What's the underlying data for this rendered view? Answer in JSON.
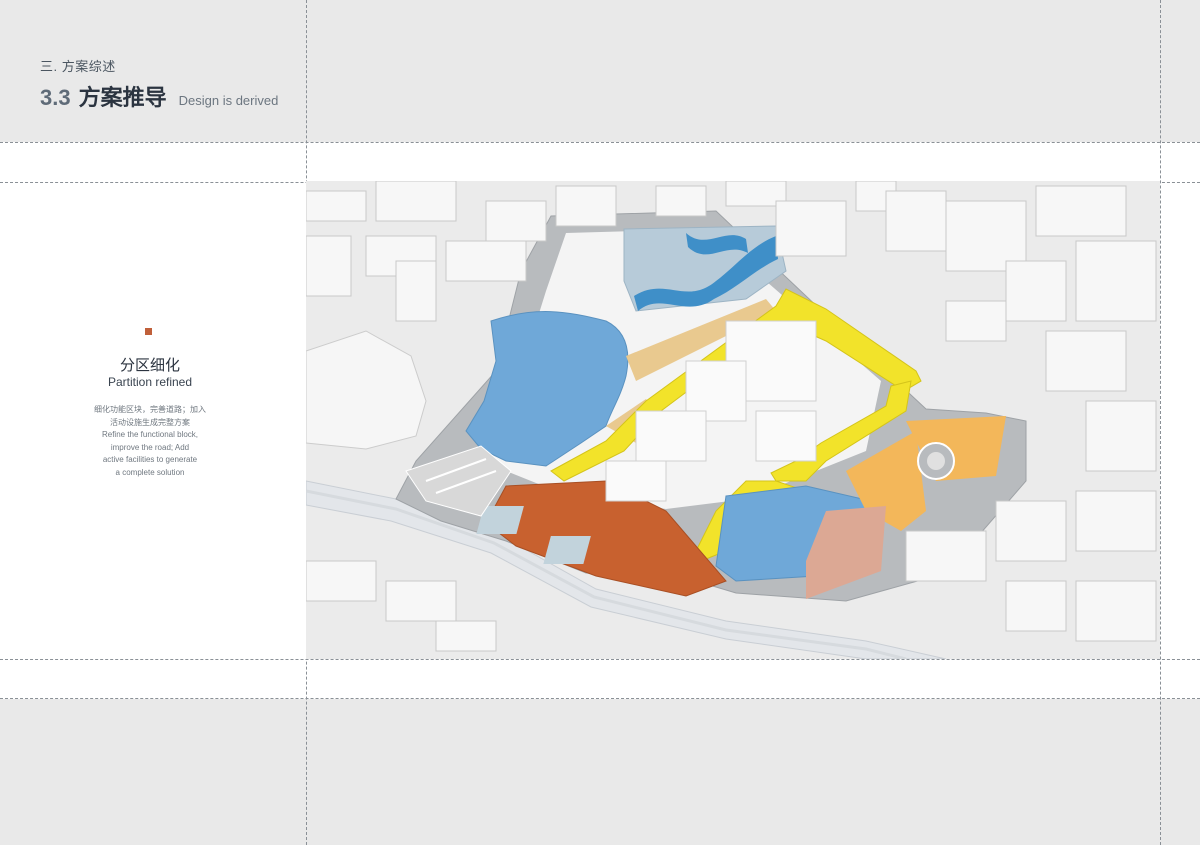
{
  "header": {
    "section": "三. 方案综述",
    "number": "3.3",
    "title_cn": "方案推导",
    "title_en": "Design is derived"
  },
  "sidebar": {
    "title_cn": "分区细化",
    "title_en": "Partition refined",
    "desc_lines": [
      "细化功能区块，完善道路；加入",
      "活动设施生成完整方案",
      "Refine the functional block,",
      "improve the road; Add",
      "active facilities to generate",
      "a complete solution"
    ]
  },
  "colors": {
    "accent_marker": "#c0603a",
    "water": "#6fa8d8",
    "path_yellow": "#f2e32a",
    "zone_orange": "#c8612f",
    "zone_light_orange": "#f3b75a",
    "zone_beige": "#e9c98f",
    "zone_pink": "#dca894",
    "road_gray": "#b5b8bb",
    "building": "#f7f7f7"
  }
}
